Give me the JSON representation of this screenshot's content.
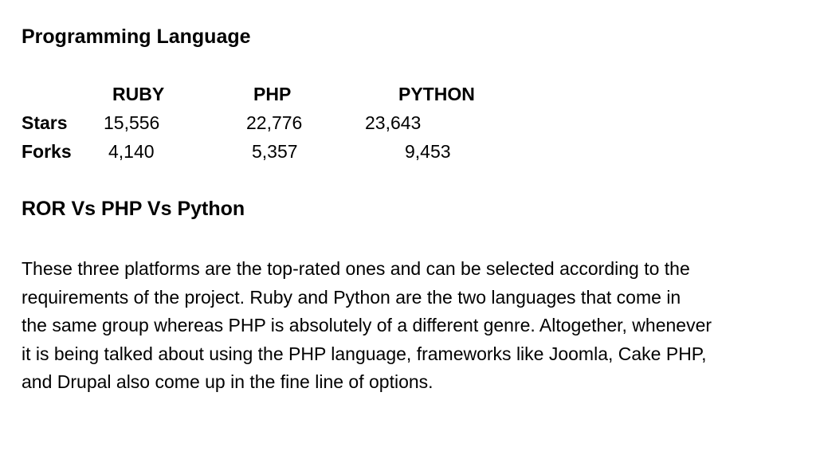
{
  "slide": {
    "heading_1": "Programming Language",
    "table": {
      "columns": [
        "RUBY",
        "PHP",
        "PYTHON"
      ],
      "rows": [
        {
          "label": "Stars",
          "values": [
            "15,556",
            "22,776",
            "23,643"
          ]
        },
        {
          "label": "Forks",
          "values": [
            "4,140",
            "5,357",
            "9,453"
          ]
        }
      ]
    },
    "heading_2": "ROR Vs PHP Vs Python",
    "paragraph_lines": [
      "These three platforms are the top-rated ones and can be selected according to the",
      "requirements of the project.  Ruby and Python are the two languages that come in",
      "the same group whereas PHP is absolutely of a different genre. Altogether, whenever",
      "it is being talked about using the PHP language, frameworks like Joomla, Cake PHP,",
      "and Drupal also come up in the fine line of options."
    ]
  }
}
